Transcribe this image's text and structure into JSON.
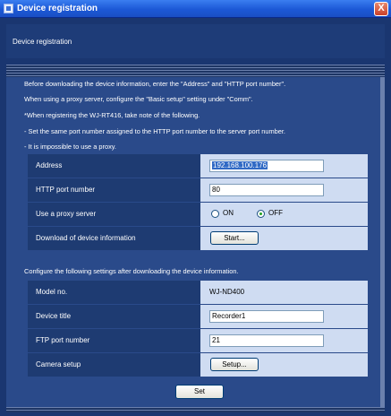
{
  "window": {
    "title": "Device registration",
    "close_label": "X"
  },
  "header": {
    "title": "Device registration"
  },
  "notes": [
    "Before downloading the device information, enter the \"Address\" and \"HTTP port number\".",
    "When using a proxy server, configure the \"Basic setup\" setting under \"Comm\".",
    "*When registering the WJ-RT416, take note of the following.",
    " - Set the same port number assigned to the HTTP port number to the server port number.",
    " - It is impossible to use a proxy."
  ],
  "section1": {
    "address_label": "Address",
    "address_value": "192.168.100.176",
    "http_label": "HTTP port number",
    "http_value": "80",
    "proxy_label": "Use a proxy server",
    "proxy_on": "ON",
    "proxy_off": "OFF",
    "proxy_selected": "OFF",
    "download_label": "Download of device information",
    "start_button": "Start..."
  },
  "section2_note": "Configure the following settings after downloading the device information.",
  "section2": {
    "model_label": "Model no.",
    "model_value": "WJ-ND400",
    "title_label": "Device title",
    "title_value": "Recorder1",
    "ftp_label": "FTP port number",
    "ftp_value": "21",
    "camera_label": "Camera setup",
    "setup_button": "Setup..."
  },
  "set_button": "Set"
}
